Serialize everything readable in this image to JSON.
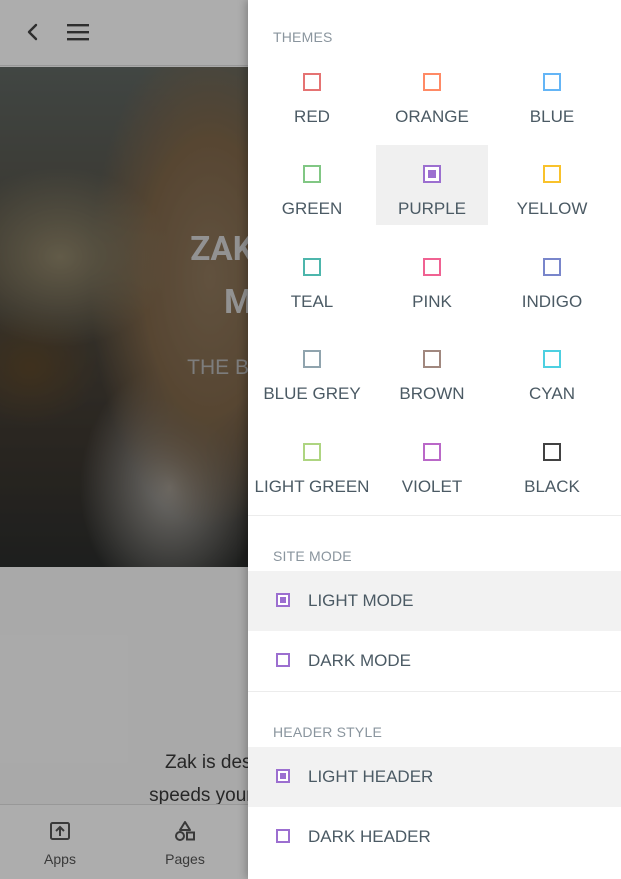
{
  "hero": {
    "title_line1": "ZAK IS I",
    "title_line2": "MO",
    "subtitle": "THE BEST M"
  },
  "intro": {
    "line1": "Zak is designed to b",
    "line2": "speeds your developme"
  },
  "bottom_nav": {
    "items": [
      {
        "label": "Apps",
        "icon": "apps-icon"
      },
      {
        "label": "Pages",
        "icon": "pages-icon"
      }
    ]
  },
  "drawer": {
    "themes_heading": "THEMES",
    "themes": [
      {
        "label": "RED",
        "color": "#e57373",
        "selected": false
      },
      {
        "label": "ORANGE",
        "color": "#ff8a65",
        "selected": false
      },
      {
        "label": "BLUE",
        "color": "#64b5f6",
        "selected": false
      },
      {
        "label": "GREEN",
        "color": "#81c784",
        "selected": false
      },
      {
        "label": "PURPLE",
        "color": "#9c6fd0",
        "selected": true
      },
      {
        "label": "YELLOW",
        "color": "#f9c22b",
        "selected": false
      },
      {
        "label": "TEAL",
        "color": "#4db6ac",
        "selected": false
      },
      {
        "label": "PINK",
        "color": "#f06292",
        "selected": false
      },
      {
        "label": "INDIGO",
        "color": "#7986cb",
        "selected": false
      },
      {
        "label": "BLUE GREY",
        "color": "#90a4ae",
        "selected": false
      },
      {
        "label": "BROWN",
        "color": "#a1887f",
        "selected": false
      },
      {
        "label": "CYAN",
        "color": "#4dd0e1",
        "selected": false
      },
      {
        "label": "LIGHT GREEN",
        "color": "#aed581",
        "selected": false
      },
      {
        "label": "VIOLET",
        "color": "#ba68c8",
        "selected": false
      },
      {
        "label": "BLACK",
        "color": "#424242",
        "selected": false
      }
    ],
    "site_mode_heading": "SITE MODE",
    "site_modes": [
      {
        "label": "LIGHT MODE",
        "selected": true
      },
      {
        "label": "DARK MODE",
        "selected": false
      }
    ],
    "header_style_heading": "HEADER STYLE",
    "header_styles": [
      {
        "label": "LIGHT HEADER",
        "selected": true
      },
      {
        "label": "DARK HEADER",
        "selected": false
      }
    ]
  }
}
